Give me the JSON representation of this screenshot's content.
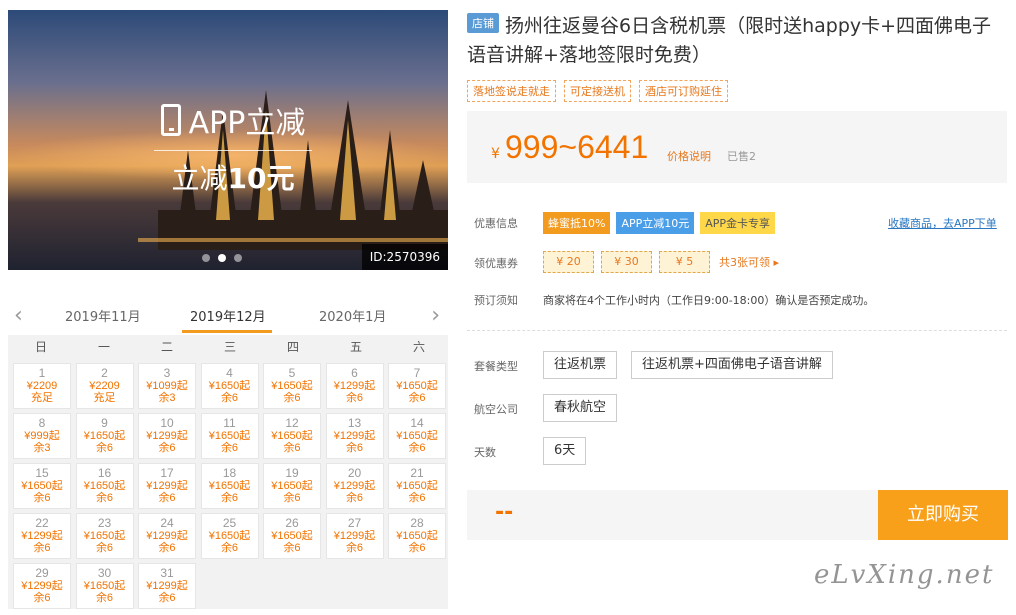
{
  "hero": {
    "promo_line1": "APP立减",
    "promo_line2_prefix": "立减",
    "promo_line2_amount": "10元",
    "id_tag": "ID:2570396"
  },
  "calendar": {
    "prev_month": "2019年11月",
    "current_month": "2019年12月",
    "next_month": "2020年1月",
    "weekdays": [
      "日",
      "一",
      "二",
      "三",
      "四",
      "五",
      "六"
    ],
    "days": [
      {
        "day": "1",
        "price": "¥2209",
        "stock": "充足"
      },
      {
        "day": "2",
        "price": "¥2209",
        "stock": "充足"
      },
      {
        "day": "3",
        "price": "¥1099起",
        "stock": "余3"
      },
      {
        "day": "4",
        "price": "¥1650起",
        "stock": "余6"
      },
      {
        "day": "5",
        "price": "¥1650起",
        "stock": "余6"
      },
      {
        "day": "6",
        "price": "¥1299起",
        "stock": "余6"
      },
      {
        "day": "7",
        "price": "¥1650起",
        "stock": "余6"
      },
      {
        "day": "8",
        "price": "¥999起",
        "stock": "余3"
      },
      {
        "day": "9",
        "price": "¥1650起",
        "stock": "余6"
      },
      {
        "day": "10",
        "price": "¥1299起",
        "stock": "余6"
      },
      {
        "day": "11",
        "price": "¥1650起",
        "stock": "余6"
      },
      {
        "day": "12",
        "price": "¥1650起",
        "stock": "余6"
      },
      {
        "day": "13",
        "price": "¥1299起",
        "stock": "余6"
      },
      {
        "day": "14",
        "price": "¥1650起",
        "stock": "余6"
      },
      {
        "day": "15",
        "price": "¥1650起",
        "stock": "余6"
      },
      {
        "day": "16",
        "price": "¥1650起",
        "stock": "余6"
      },
      {
        "day": "17",
        "price": "¥1299起",
        "stock": "余6"
      },
      {
        "day": "18",
        "price": "¥1650起",
        "stock": "余6"
      },
      {
        "day": "19",
        "price": "¥1650起",
        "stock": "余6"
      },
      {
        "day": "20",
        "price": "¥1299起",
        "stock": "余6"
      },
      {
        "day": "21",
        "price": "¥1650起",
        "stock": "余6"
      },
      {
        "day": "22",
        "price": "¥1299起",
        "stock": "余6"
      },
      {
        "day": "23",
        "price": "¥1650起",
        "stock": "余6"
      },
      {
        "day": "24",
        "price": "¥1299起",
        "stock": "余6"
      },
      {
        "day": "25",
        "price": "¥1650起",
        "stock": "余6"
      },
      {
        "day": "26",
        "price": "¥1650起",
        "stock": "余6"
      },
      {
        "day": "27",
        "price": "¥1299起",
        "stock": "余6"
      },
      {
        "day": "28",
        "price": "¥1650起",
        "stock": "余6"
      },
      {
        "day": "29",
        "price": "¥1299起",
        "stock": "余6"
      },
      {
        "day": "30",
        "price": "¥1650起",
        "stock": "余6"
      },
      {
        "day": "31",
        "price": "¥1299起",
        "stock": "余6"
      }
    ]
  },
  "product": {
    "badge": "店铺",
    "title": "扬州往返曼谷6日含税机票（限时送happy卡+四面佛电子语音讲解+落地签限时免费）",
    "tags": [
      "落地签说走就走",
      "可定接送机",
      "酒店可订购延住"
    ],
    "currency": "¥",
    "price": "999~6441",
    "price_note": "价格说明",
    "sold": "已售2"
  },
  "info": {
    "discount_label": "优惠信息",
    "discount_badges": [
      "蜂蜜抵10%",
      "APP立减10元",
      "APP金卡专享"
    ],
    "fav_link": "收藏商品，去APP下单",
    "coupon_label": "领优惠券",
    "coupons": [
      "¥ 20",
      "¥ 30",
      "¥ 5"
    ],
    "coupon_more": "共3张可领 ▸",
    "notice_label": "预订须知",
    "notice_text": "商家将在4个工作小时内（工作日9:00-18:00）确认是否预定成功。"
  },
  "options": {
    "package_label": "套餐类型",
    "package_opt1": "往返机票",
    "package_opt2": "往返机票+四面佛电子语音讲解",
    "airline_label": "航空公司",
    "airline_opt": "春秋航空",
    "days_label": "天数",
    "days_opt": "6天"
  },
  "buy": {
    "total_placeholder": "--",
    "button": "立即购买"
  },
  "watermark": "eLvXing.net",
  "colors": {
    "accent_orange": "#f27300",
    "buy_button": "#f9a01b",
    "link_blue": "#2a78c2"
  }
}
